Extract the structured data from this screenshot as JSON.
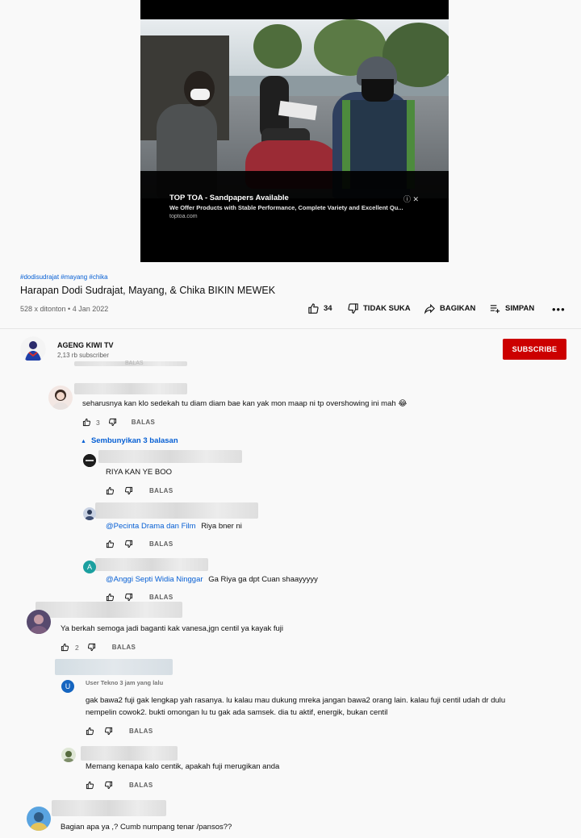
{
  "video": {
    "ad_title": "TOP TOA - Sandpapers Available",
    "ad_description": "We Offer Products with Stable Performance, Complete Variety and Excellent Qu...",
    "ad_url": "toptoa.com"
  },
  "meta": {
    "hashtags": "#dodisudrajat #mayang #chika",
    "title": "Harapan Dodi Sudrajat, Mayang, & Chika BIKIN MEWEK",
    "stats": "528 x ditonton • 4 Jan 2022"
  },
  "actions": {
    "like_count": "34",
    "dislike_label": "TIDAK SUKA",
    "share_label": "BAGIKAN",
    "save_label": "SIMPAN",
    "more_label": "•••"
  },
  "channel": {
    "name": "AGENG KIWI TV",
    "subscribers": "2,13 rb subscriber",
    "subscribe_label": "SUBSCRIBE"
  },
  "comments": {
    "top_partial": "BALAS",
    "c1": {
      "text": "seharusnya kan klo sedekah tu diam diam bae kan yak mon maap ni tp overshowing ini mah",
      "likes": "3",
      "reply": "BALAS"
    },
    "hide_replies": "Sembunyikan 3 balasan",
    "r1": {
      "text": "RIYA KAN YE BOO",
      "reply": "BALAS"
    },
    "r2": {
      "mention": "@Pecinta Drama dan Film",
      "text": "Riya bner ni",
      "reply": "BALAS"
    },
    "r3": {
      "avatar_letter": "A",
      "mention": "@Anggi Septi Widia Ninggar",
      "text": "Ga Riya ga dpt Cuan shaayyyyy",
      "reply": "BALAS"
    },
    "c2": {
      "text": "Ya berkah semoga jadi baganti kak vanesa,jgn centil ya kayak fuji",
      "likes": "2",
      "reply": "BALAS"
    },
    "r4": {
      "avatar_letter": "U",
      "header": "User Tekno  3 jam yang lalu",
      "line1": "gak bawa2 fuji gak lengkap yah rasanya. lu kalau mau dukung mreka jangan bawa2 orang lain. kalau fuji centil udah dr dulu",
      "line2": "nempelin cowok2. bukti omongan lu tu gak ada samsek. dia tu aktif, energik, bukan centil",
      "reply": "BALAS"
    },
    "r5": {
      "text": "Memang kenapa kalo centik, apakah fuji merugikan anda",
      "reply": "BALAS"
    },
    "c3": {
      "text": "Bagian apa ya ,? Cumb numpang tenar /pansos??"
    }
  },
  "colors": {
    "subscribe": "#cc0000",
    "link": "#065fd4",
    "avatar_a": "#1ba0a0",
    "avatar_u": "#1565c0"
  },
  "icons": [
    "like-icon",
    "dislike-icon",
    "share-icon",
    "save-icon",
    "more-icon",
    "info-icon",
    "close-icon",
    "chevron-up-icon"
  ]
}
